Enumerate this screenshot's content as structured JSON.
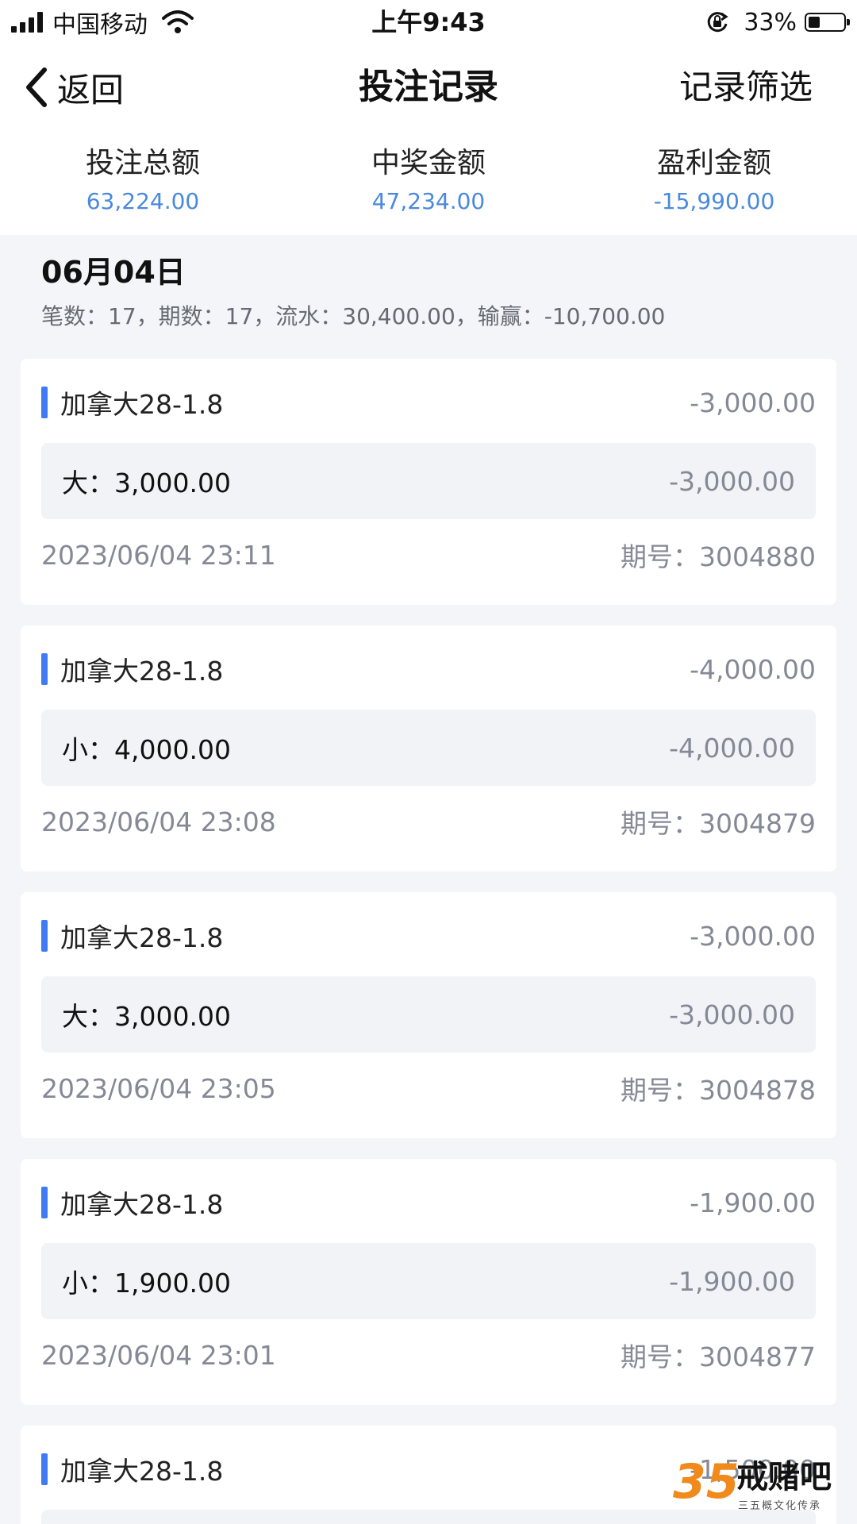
{
  "status_bar": {
    "carrier": "中国移动",
    "time": "上午9:43",
    "battery_percent": "33%",
    "battery_level": 0.33
  },
  "nav": {
    "back_label": "返回",
    "title": "投注记录",
    "filter_label": "记录筛选"
  },
  "summary": [
    {
      "label": "投注总额",
      "value": "63,224.00"
    },
    {
      "label": "中奖金额",
      "value": "47,234.00"
    },
    {
      "label": "盈利金额",
      "value": "-15,990.00"
    }
  ],
  "group": {
    "date": "06月04日",
    "stats": "笔数：17，期数：17，流水：30,400.00，输赢：-10,700.00"
  },
  "records": [
    {
      "game": "加拿大28-1.8",
      "amount": "-3,000.00",
      "bet": "大：3,000.00",
      "bet_result": "-3,000.00",
      "time": "2023/06/04 23:11",
      "period": "期号：3004880"
    },
    {
      "game": "加拿大28-1.8",
      "amount": "-4,000.00",
      "bet": "小：4,000.00",
      "bet_result": "-4,000.00",
      "time": "2023/06/04 23:08",
      "period": "期号：3004879"
    },
    {
      "game": "加拿大28-1.8",
      "amount": "-3,000.00",
      "bet": "大：3,000.00",
      "bet_result": "-3,000.00",
      "time": "2023/06/04 23:05",
      "period": "期号：3004878"
    },
    {
      "game": "加拿大28-1.8",
      "amount": "-1,900.00",
      "bet": "小：1,900.00",
      "bet_result": "-1,900.00",
      "time": "2023/06/04 23:01",
      "period": "期号：3004877"
    },
    {
      "game": "加拿大28-1.8",
      "amount": "-1,500.00"
    }
  ],
  "watermark": {
    "logo": "35",
    "name": "戒赌吧",
    "subtitle": "三五概文化传承"
  },
  "colors": {
    "accent": "#3e7bf5",
    "summary_value": "#4a89dc",
    "muted": "#858996",
    "background": "#f4f5f8"
  }
}
